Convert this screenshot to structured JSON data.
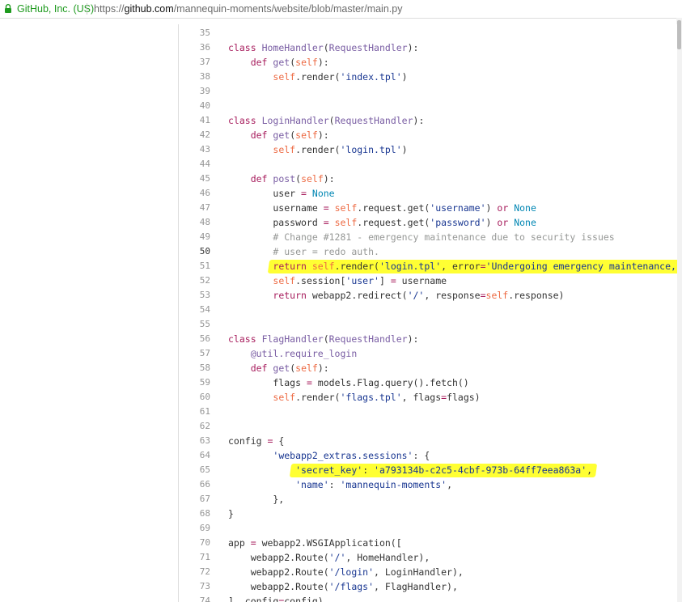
{
  "browser": {
    "site_identity": "GitHub, Inc. (US)",
    "url_scheme": "https://",
    "url_host": "github.com",
    "url_path": "/mannequin-moments/website/blob/master/main.py",
    "lock_icon": "lock-icon"
  },
  "colors": {
    "highlight": "#ffff33",
    "keyword": "#a71d5d",
    "string": "#183691",
    "comment": "#969896",
    "builtin": "#0086b3"
  },
  "code": {
    "current_line": 50,
    "highlighted_lines": [
      51,
      65
    ],
    "lines": [
      {
        "n": "35",
        "text": ""
      },
      {
        "n": "36",
        "text": "class HomeHandler(RequestHandler):"
      },
      {
        "n": "37",
        "text": "    def get(self):"
      },
      {
        "n": "38",
        "text": "        self.render('index.tpl')"
      },
      {
        "n": "39",
        "text": ""
      },
      {
        "n": "40",
        "text": ""
      },
      {
        "n": "41",
        "text": "class LoginHandler(RequestHandler):"
      },
      {
        "n": "42",
        "text": "    def get(self):"
      },
      {
        "n": "43",
        "text": "        self.render('login.tpl')"
      },
      {
        "n": "44",
        "text": ""
      },
      {
        "n": "45",
        "text": "    def post(self):"
      },
      {
        "n": "46",
        "text": "        user = None"
      },
      {
        "n": "47",
        "text": "        username = self.request.get('username') or None"
      },
      {
        "n": "48",
        "text": "        password = self.request.get('password') or None"
      },
      {
        "n": "49",
        "text": "        # Change #1281 - emergency maintenance due to security issues"
      },
      {
        "n": "50",
        "text": "        # user = redo auth."
      },
      {
        "n": "51",
        "text": "        return self.render('login.tpl', error='Undergoing emergency maintenance,"
      },
      {
        "n": "52",
        "text": "        self.session['user'] = username"
      },
      {
        "n": "53",
        "text": "        return webapp2.redirect('/', response=self.response)"
      },
      {
        "n": "54",
        "text": ""
      },
      {
        "n": "55",
        "text": ""
      },
      {
        "n": "56",
        "text": "class FlagHandler(RequestHandler):"
      },
      {
        "n": "57",
        "text": "    @util.require_login"
      },
      {
        "n": "58",
        "text": "    def get(self):"
      },
      {
        "n": "59",
        "text": "        flags = models.Flag.query().fetch()"
      },
      {
        "n": "60",
        "text": "        self.render('flags.tpl', flags=flags)"
      },
      {
        "n": "61",
        "text": ""
      },
      {
        "n": "62",
        "text": ""
      },
      {
        "n": "63",
        "text": "config = {"
      },
      {
        "n": "64",
        "text": "        'webapp2_extras.sessions': {"
      },
      {
        "n": "65",
        "text": "            'secret_key': 'a793134b-c2c5-4cbf-973b-64ff7eea863a',"
      },
      {
        "n": "66",
        "text": "            'name': 'mannequin-moments',"
      },
      {
        "n": "67",
        "text": "        },"
      },
      {
        "n": "68",
        "text": "}"
      },
      {
        "n": "69",
        "text": ""
      },
      {
        "n": "70",
        "text": "app = webapp2.WSGIApplication(["
      },
      {
        "n": "71",
        "text": "    webapp2.Route('/', HomeHandler),"
      },
      {
        "n": "72",
        "text": "    webapp2.Route('/login', LoginHandler),"
      },
      {
        "n": "73",
        "text": "    webapp2.Route('/flags', FlagHandler),"
      },
      {
        "n": "74",
        "text": "], config=config)"
      }
    ]
  }
}
